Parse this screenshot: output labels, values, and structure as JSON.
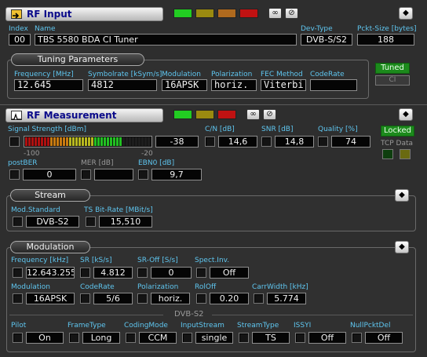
{
  "colors": {
    "label": "#5fc6f0",
    "label_disabled": "#9a9a9a",
    "title_text": "#0a0a8a",
    "led_green": "#22cc22",
    "led_olive": "#9a8a10",
    "led_orange": "#b06a1e",
    "led_red": "#c01212"
  },
  "rf_input": {
    "title": "RF Input",
    "icon": "arrow-in-icon",
    "index": {
      "label": "Index",
      "value": "00"
    },
    "name": {
      "label": "Name",
      "value": "TBS 5580 BDA CI Tuner"
    },
    "dev_type": {
      "label": "Dev-Type",
      "value": "DVB-S/S2"
    },
    "pkt_size": {
      "label": "Pckt-Size [bytes]",
      "value": "188"
    },
    "tuning": {
      "title": "Tuning Parameters",
      "frequency": {
        "label": "Frequency [MHz]",
        "value": "12.645"
      },
      "symbolrate": {
        "label": "Symbolrate [kSym/s]",
        "value": "4812"
      },
      "modulation": {
        "label": "Modulation",
        "value": "16APSK"
      },
      "polarization": {
        "label": "Polarization",
        "value": "horiz."
      },
      "fec": {
        "label": "FEC Method",
        "value": "Viterbi"
      },
      "coderate": {
        "label": "CodeRate",
        "value": ""
      }
    },
    "tuned_button": "Tuned",
    "ci_button": "CI"
  },
  "rf_measurement": {
    "title": "RF Measurement",
    "icon": "waveform-icon",
    "signal": {
      "label": "Signal Strength [dBm]",
      "value": "-38",
      "scale_min": "-100",
      "scale_max": "-20",
      "level": 0.775
    },
    "cn": {
      "label": "C/N [dB]",
      "value": "14,6"
    },
    "snr": {
      "label": "SNR [dB]",
      "value": "14,8"
    },
    "quality": {
      "label": "Quality [%]",
      "value": "74"
    },
    "locked_button": "Locked",
    "tcp_data": "TCP Data",
    "postber": {
      "label": "postBER",
      "value": "0"
    },
    "mer": {
      "label": "MER [dB]",
      "value": ""
    },
    "ebn0": {
      "label": "EBN0 [dB]",
      "value": "9,7"
    }
  },
  "stream": {
    "title": "Stream",
    "mod_standard": {
      "label": "Mod.Standard",
      "value": "DVB-S2"
    },
    "ts_bitrate": {
      "label": "TS Bit-Rate [MBit/s]",
      "value": "15,510"
    }
  },
  "modulation": {
    "title": "Modulation",
    "frequency": {
      "label": "Frequency [kHz]",
      "value": "12.643.255"
    },
    "sr": {
      "label": "SR [kS/s]",
      "value": "4.812"
    },
    "sr_off": {
      "label": "SR-Off [S/s]",
      "value": "0"
    },
    "spect_inv": {
      "label": "Spect.Inv.",
      "value": "Off"
    },
    "modulation": {
      "label": "Modulation",
      "value": "16APSK"
    },
    "coderate": {
      "label": "CodeRate",
      "value": "5/6"
    },
    "polarization": {
      "label": "Polarization",
      "value": "horiz."
    },
    "roloff": {
      "label": "RolOff",
      "value": "0.20"
    },
    "carrwidth": {
      "label": "CarrWidth [kHz]",
      "value": "5.774"
    },
    "dvbs2_title": "DVB-S2",
    "pilot": {
      "label": "Pilot",
      "value": "On"
    },
    "frametype": {
      "label": "FrameType",
      "value": "Long"
    },
    "codingmode": {
      "label": "CodingMode",
      "value": "CCM"
    },
    "inputstream": {
      "label": "InputStream",
      "value": "single"
    },
    "streamtype": {
      "label": "StreamType",
      "value": "TS"
    },
    "issyi": {
      "label": "ISSYI",
      "value": "Off"
    },
    "nullpkt": {
      "label": "NullPcktDel",
      "value": "Off"
    }
  }
}
